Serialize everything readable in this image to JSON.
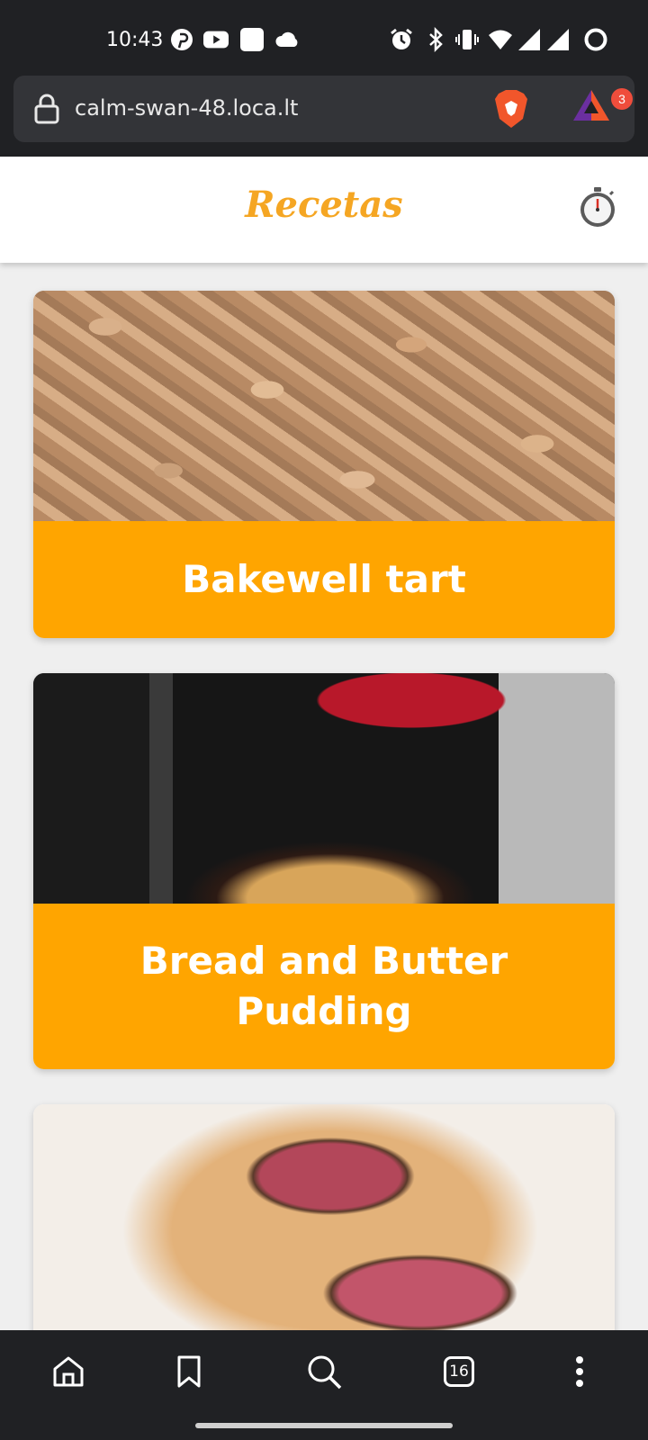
{
  "status_bar": {
    "time": "10:43",
    "icons": [
      "pinterest-icon",
      "youtube-icon",
      "square-app-icon",
      "cloud-icon",
      "alarm-icon",
      "bluetooth-icon",
      "vibrate-icon",
      "wifi-icon",
      "signal-icon",
      "signal-icon-2",
      "battery-ring-icon"
    ]
  },
  "browser": {
    "url": "calm-swan-48.loca.lt",
    "rewards_badge": "3",
    "tab_count": "16"
  },
  "app": {
    "title": "Recetas",
    "accent_color": "#ffa500"
  },
  "recipes": [
    {
      "title": "Bakewell tart"
    },
    {
      "title": "Bread and Butter Pudding"
    },
    {
      "title": ""
    }
  ]
}
